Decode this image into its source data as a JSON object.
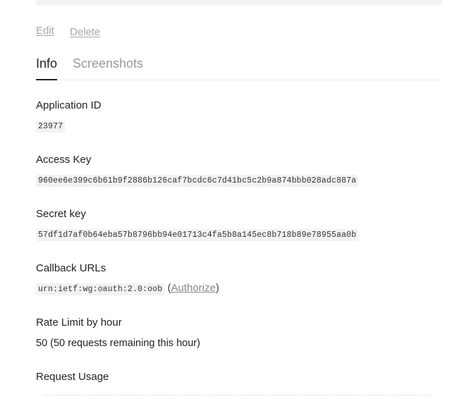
{
  "actions": {
    "edit_label": "Edit",
    "delete_label": "Delete"
  },
  "tabs": [
    {
      "label": "Info",
      "active": true
    },
    {
      "label": "Screenshots",
      "active": false
    }
  ],
  "fields": {
    "application_id": {
      "label": "Application ID",
      "value": "23977"
    },
    "access_key": {
      "label": "Access Key",
      "value": "960ee6e399c6b61b9f2886b126caf7bcdc6c7d41bc5c2b9a874bbb028adc887a"
    },
    "secret_key": {
      "label": "Secret key",
      "value": "57df1d7af0b64eba57b8796bb94e01713c4fa5b8a145ec8b718b89e78955aa0b"
    },
    "callback_urls": {
      "label": "Callback URLs",
      "value": "urn:ietf:wg:oauth:2.0:oob",
      "open_paren": "(",
      "authorize_label": "Authorize",
      "close_paren": ")"
    },
    "rate_limit": {
      "label": "Rate Limit by hour",
      "value": "50 (50 requests remaining this hour)"
    },
    "request_usage": {
      "label": "Request Usage"
    }
  },
  "colors": {
    "active_tab": "#222222",
    "inactive_tab": "#999999",
    "link": "#a6a6a6",
    "code_bg": "#f2f2f2"
  }
}
